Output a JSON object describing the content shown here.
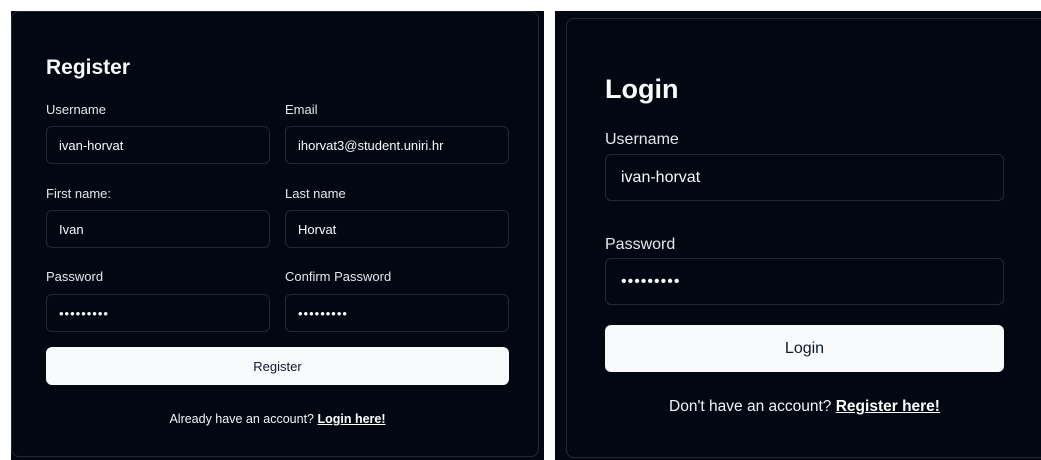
{
  "register": {
    "title": "Register",
    "username_label": "Username",
    "username_value": "ivan-horvat",
    "email_label": "Email",
    "email_value": "ihorvat3@student.uniri.hr",
    "first_name_label": "First name:",
    "first_name_value": "Ivan",
    "last_name_label": "Last name",
    "last_name_value": "Horvat",
    "password_label": "Password",
    "password_value": "•••••••••",
    "confirm_password_label": "Confirm Password",
    "confirm_password_value": "•••••••••",
    "submit_label": "Register",
    "footer_text": "Already have an account?",
    "footer_link": "Login here!"
  },
  "login": {
    "title": "Login",
    "username_label": "Username",
    "username_value": "ivan-horvat",
    "password_label": "Password",
    "password_value": "•••••••••",
    "submit_label": "Login",
    "footer_text": "Don't have an account?",
    "footer_link": "Register here!"
  },
  "colors": {
    "background": "#030712",
    "border": "#1f2937",
    "button_bg": "#f8fafc",
    "button_text": "#0f172a",
    "text": "#f8fafc"
  }
}
